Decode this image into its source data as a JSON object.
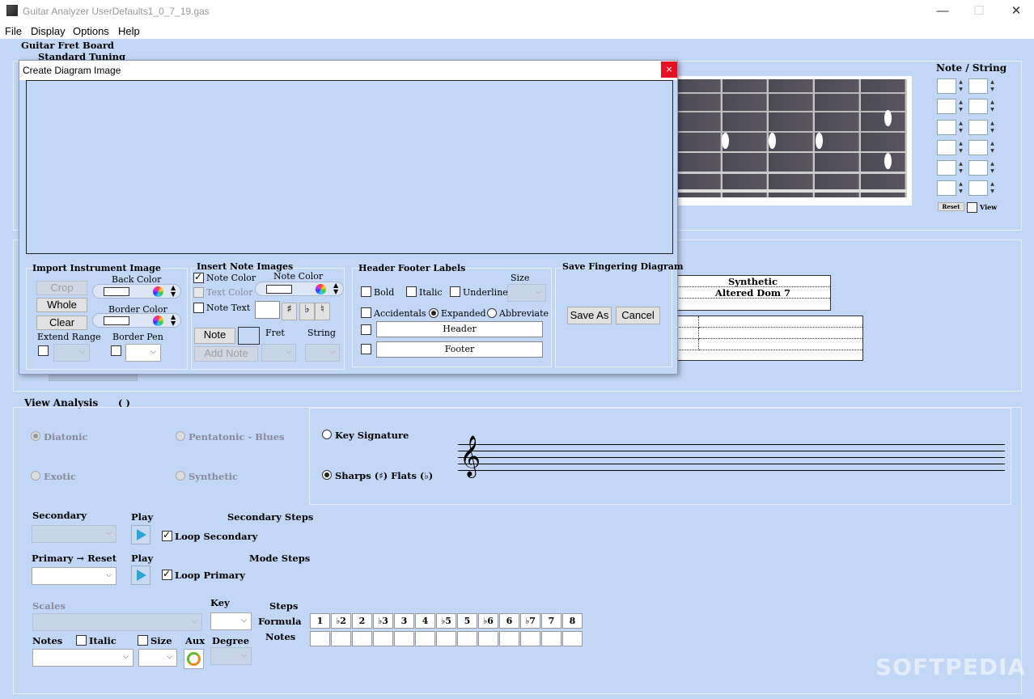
{
  "window": {
    "title": "Guitar Analyzer  UserDefaults1_0_7_19.gas",
    "min": "—",
    "max": "☐",
    "close": "✕"
  },
  "menu": [
    "File",
    "Display",
    "Options",
    "Help"
  ],
  "fretboard": {
    "title": "Guitar Fret Board",
    "tuning": "Standard Tuning"
  },
  "note_string": {
    "title": "Note / String",
    "reset": "Reset",
    "view": "View"
  },
  "scale_table": {
    "row1": "Synthetic",
    "row2": "Altered Dom 7"
  },
  "dialog": {
    "title": "Create Diagram Image",
    "close": "×",
    "import": {
      "title": "Import Instrument Image",
      "crop": "Crop",
      "whole": "Whole",
      "clear": "Clear",
      "back_color": "Back Color",
      "border_color": "Border Color",
      "extend_range": "Extend Range",
      "border_pen": "Border Pen"
    },
    "insert": {
      "title": "Insert Note Images",
      "note_color_chk": "Note Color",
      "note_color": "Note Color",
      "text_color": "Text Color",
      "note_text": "Note Text",
      "sharp": "♯",
      "flat": "♭",
      "natural": "♮",
      "note_btn": "Note",
      "add_note": "Add Note",
      "fret": "Fret",
      "string": "String"
    },
    "header": {
      "title": "Header Footer Labels",
      "size": "Size",
      "bold": "Bold",
      "italic": "Italic",
      "underline": "Underline",
      "accidentals": "Accidentals",
      "expanded": "Expanded",
      "abbreviate": "Abbreviate",
      "header": "Header",
      "footer": "Footer"
    },
    "save": {
      "title": "Save Fingering Diagram",
      "save_as": "Save As",
      "cancel": "Cancel"
    }
  },
  "analysis": {
    "title": "View Analysis",
    "paren": "(  )",
    "diatonic": "Diatonic",
    "pentatonic": "Pentatonic - Blues",
    "exotic": "Exotic",
    "synthetic": "Synthetic",
    "key_signature": "Key Signature",
    "sharps_flats": "Sharps (♯)  Flats (♭)",
    "secondary": "Secondary",
    "play": "Play",
    "secondary_steps": "Secondary Steps",
    "loop_secondary": "Loop Secondary",
    "primary_reset": "Primary → Reset",
    "mode_steps": "Mode Steps",
    "loop_primary": "Loop Primary",
    "scales": "Scales",
    "key": "Key",
    "steps": "Steps",
    "formula": "Formula",
    "notes_label": "Notes",
    "notes": "Notes",
    "italic": "Italic",
    "size": "Size",
    "aux": "Aux",
    "degree": "Degree",
    "formula_values": [
      "1",
      "♭2",
      "2",
      "♭3",
      "3",
      "4",
      "♭5",
      "5",
      "♭6",
      "6",
      "♭7",
      "7",
      "8"
    ]
  },
  "watermark": "SOFTPEDIA"
}
